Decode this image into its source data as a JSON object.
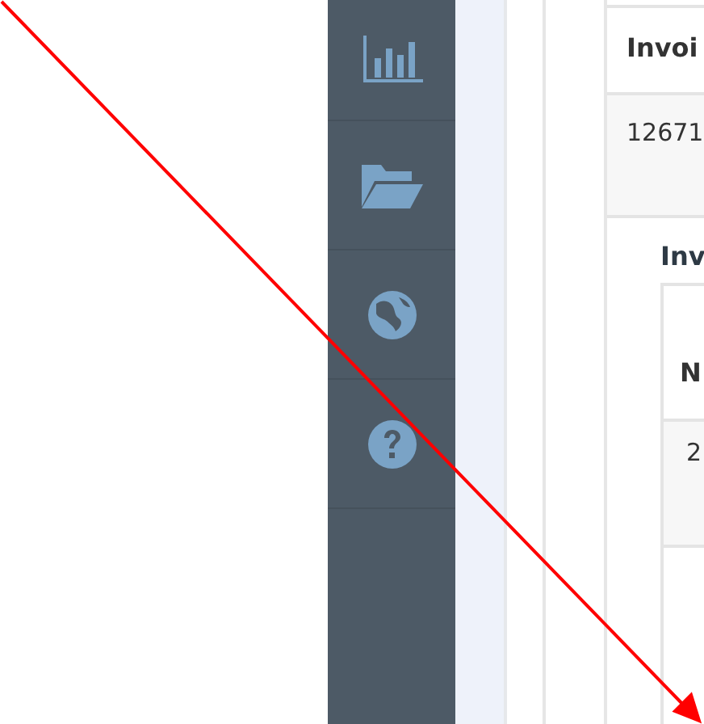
{
  "sidebar": {
    "items": [
      {
        "kind": "chart"
      },
      {
        "kind": "folder"
      },
      {
        "kind": "globe"
      },
      {
        "kind": "help"
      }
    ]
  },
  "table": {
    "columns": [
      "Invoi"
    ],
    "rows": [
      [
        "12671"
      ]
    ]
  },
  "subsection": {
    "title": "Inv",
    "table": {
      "columns": [
        "N"
      ],
      "rows": [
        [
          "2"
        ]
      ]
    }
  },
  "annotation": {
    "kind": "arrow"
  }
}
